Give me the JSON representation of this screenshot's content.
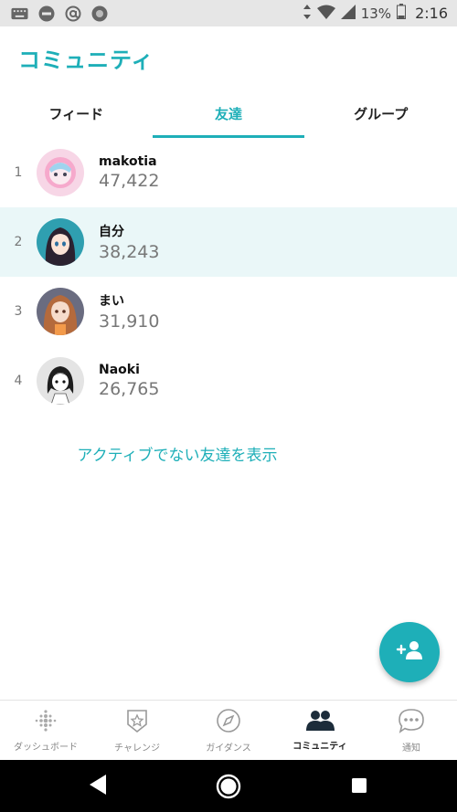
{
  "status_bar": {
    "battery": "13%",
    "time": "2:16",
    "icons": [
      "keyboard-icon",
      "dnd-icon",
      "at-icon",
      "record-icon",
      "data-arrows-icon",
      "wifi-icon",
      "signal-icon",
      "battery-icon"
    ]
  },
  "header": {
    "title": "コミュニティ",
    "tabs": [
      {
        "label": "フィード",
        "active": false
      },
      {
        "label": "友達",
        "active": true
      },
      {
        "label": "グループ",
        "active": false
      }
    ]
  },
  "leaderboard": {
    "rows": [
      {
        "rank": "1",
        "name": "makotia",
        "steps": "47,422",
        "highlight": false
      },
      {
        "rank": "2",
        "name": "自分",
        "steps": "38,243",
        "highlight": true
      },
      {
        "rank": "3",
        "name": "まい",
        "steps": "31,910",
        "highlight": false
      },
      {
        "rank": "4",
        "name": "Naoki",
        "steps": "26,765",
        "highlight": false
      }
    ],
    "show_inactive_label": "アクティブでない友達を表示"
  },
  "fab": {
    "icon": "add-friend-icon",
    "label": "+"
  },
  "bottom_nav": [
    {
      "label": "ダッシュボード",
      "icon": "dashboard-dots-icon",
      "active": false
    },
    {
      "label": "チャレンジ",
      "icon": "challenge-star-icon",
      "active": false
    },
    {
      "label": "ガイダンス",
      "icon": "compass-icon",
      "active": false
    },
    {
      "label": "コミュニティ",
      "icon": "community-icon",
      "active": true
    },
    {
      "label": "通知",
      "icon": "chat-bubble-icon",
      "active": false
    }
  ],
  "colors": {
    "accent": "#1eafb8",
    "highlight_row": "#eaf7f8",
    "status_bar": "#e6e6e6"
  }
}
